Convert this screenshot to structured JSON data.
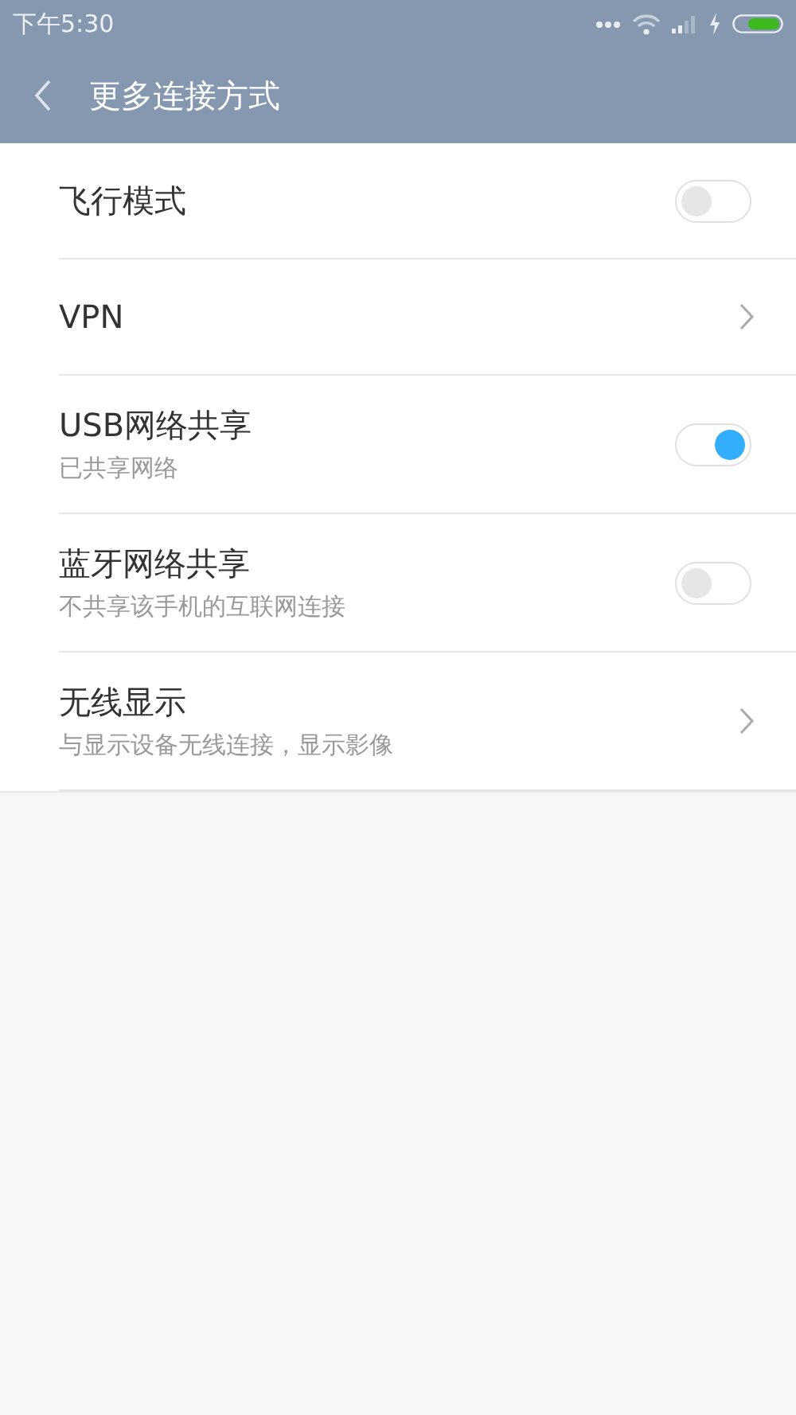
{
  "status_bar": {
    "time": "下午5:30"
  },
  "title_bar": {
    "title": "更多连接方式"
  },
  "settings": [
    {
      "kind": "toggle",
      "title": "飞行模式",
      "on": false
    },
    {
      "kind": "link",
      "title": "VPN"
    },
    {
      "kind": "toggle",
      "title": "USB网络共享",
      "subtitle": "已共享网络",
      "on": true
    },
    {
      "kind": "toggle",
      "title": "蓝牙网络共享",
      "subtitle": "不共享该手机的互联网连接",
      "on": false
    },
    {
      "kind": "link",
      "title": "无线显示",
      "subtitle": "与显示设备无线连接，显示影像"
    }
  ]
}
